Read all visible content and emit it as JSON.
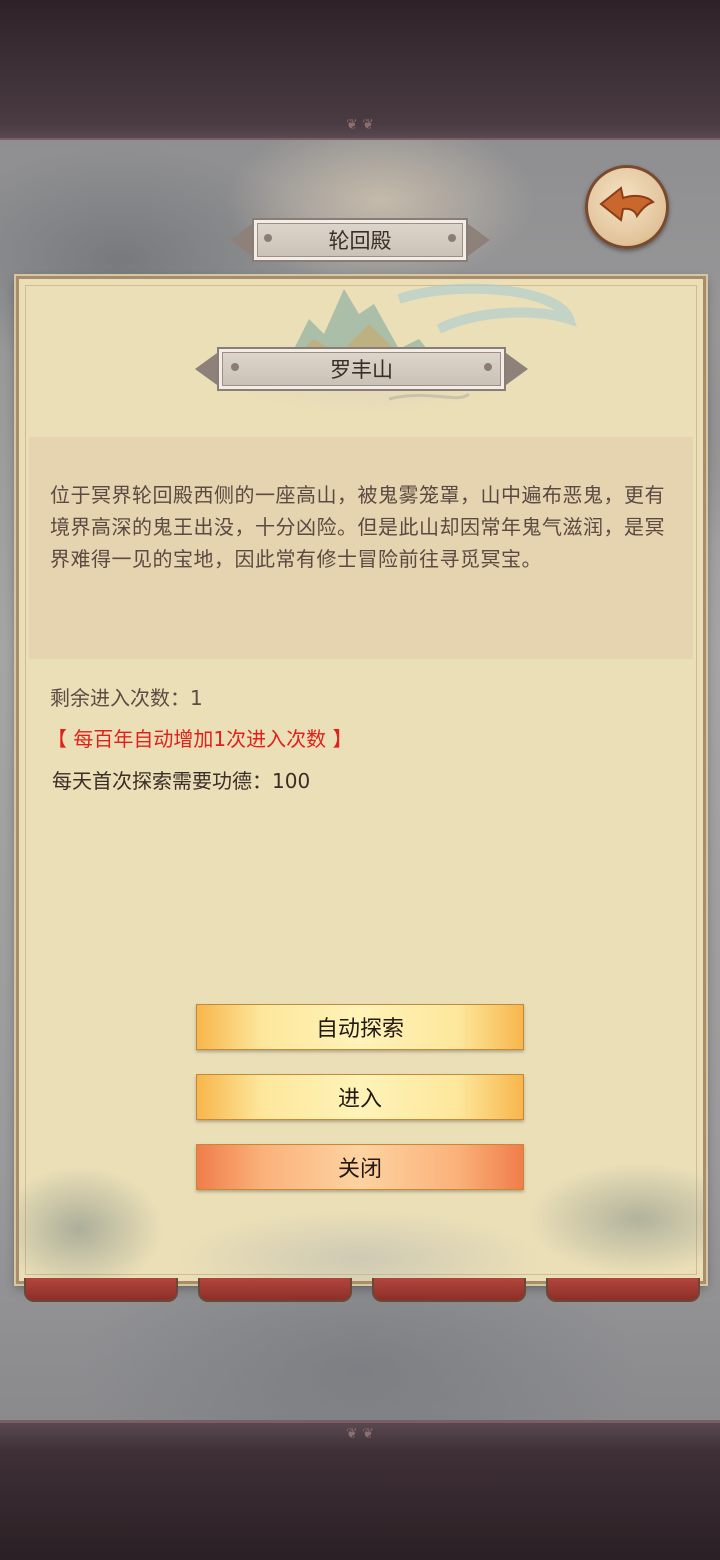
{
  "header": {
    "title": "轮回殿"
  },
  "location": {
    "name": "罗丰山",
    "description": "位于冥界轮回殿西侧的一座高山，被鬼雾笼罩，山中遍布恶鬼，更有境界高深的鬼王出没，十分凶险。但是此山却因常年鬼气滋润，是冥界难得一见的宝地，因此常有修士冒险前往寻觅冥宝。"
  },
  "info": {
    "remaining_entries": "剩余进入次数：1",
    "auto_increase_note": "【 每百年自动增加1次进入次数 】",
    "daily_cost": "每天首次探索需要功德：100"
  },
  "buttons": {
    "auto_explore": "自动探索",
    "enter": "进入",
    "close": "关闭"
  },
  "icons": {
    "back": "back-arrow-icon"
  },
  "colors": {
    "panel_bg": "#ebdfb7",
    "note_red": "#e0211b",
    "button_gold": "#fde79c",
    "button_orange": "#fbb17a"
  }
}
